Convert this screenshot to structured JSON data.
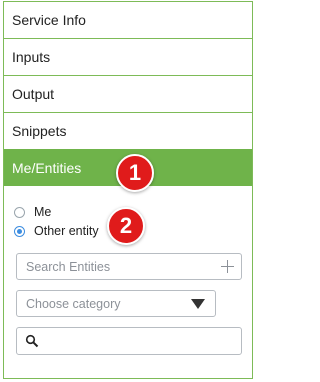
{
  "sections": [
    {
      "label": "Service Info"
    },
    {
      "label": "Inputs"
    },
    {
      "label": "Output"
    },
    {
      "label": "Snippets"
    },
    {
      "label": "Me/Entities"
    }
  ],
  "callouts": [
    "1",
    "2"
  ],
  "entity_options": [
    {
      "label": "Me",
      "selected": false
    },
    {
      "label": "Other entity",
      "selected": true
    }
  ],
  "search_entities": {
    "placeholder": "Search Entities"
  },
  "category_select": {
    "placeholder": "Choose category"
  },
  "search_box": {
    "value": ""
  },
  "colors": {
    "accent_green": "#6fb34a",
    "callout_red": "#e01b1b",
    "radio_blue": "#3d8de0"
  }
}
